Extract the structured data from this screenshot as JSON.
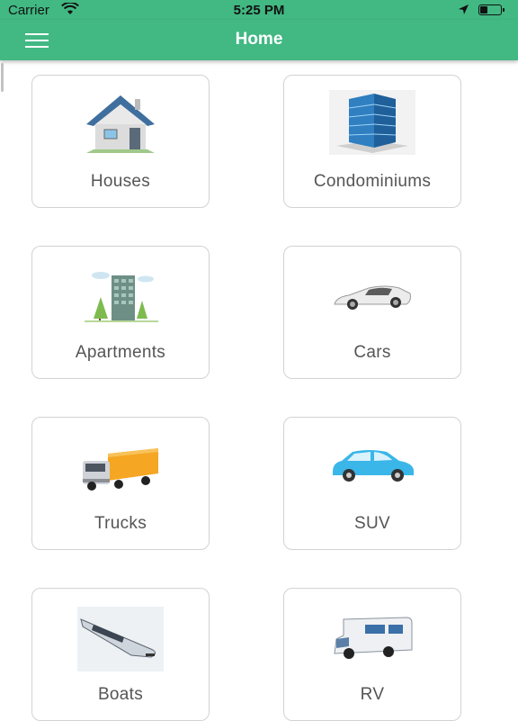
{
  "status_bar": {
    "carrier": "Carrier",
    "time": "5:25 PM"
  },
  "nav": {
    "title": "Home"
  },
  "categories": [
    {
      "label": "Houses",
      "icon": "house-icon"
    },
    {
      "label": "Condominiums",
      "icon": "condominium-building-icon"
    },
    {
      "label": "Apartments",
      "icon": "apartment-building-icon"
    },
    {
      "label": "Cars",
      "icon": "sports-car-icon"
    },
    {
      "label": "Trucks",
      "icon": "truck-icon"
    },
    {
      "label": "SUV",
      "icon": "suv-icon"
    },
    {
      "label": "Boats",
      "icon": "speedboat-icon"
    },
    {
      "label": "RV",
      "icon": "rv-camper-icon"
    }
  ],
  "colors": {
    "primary": "#42b883",
    "card_border": "#d2d2d2",
    "label_text": "#555555"
  }
}
